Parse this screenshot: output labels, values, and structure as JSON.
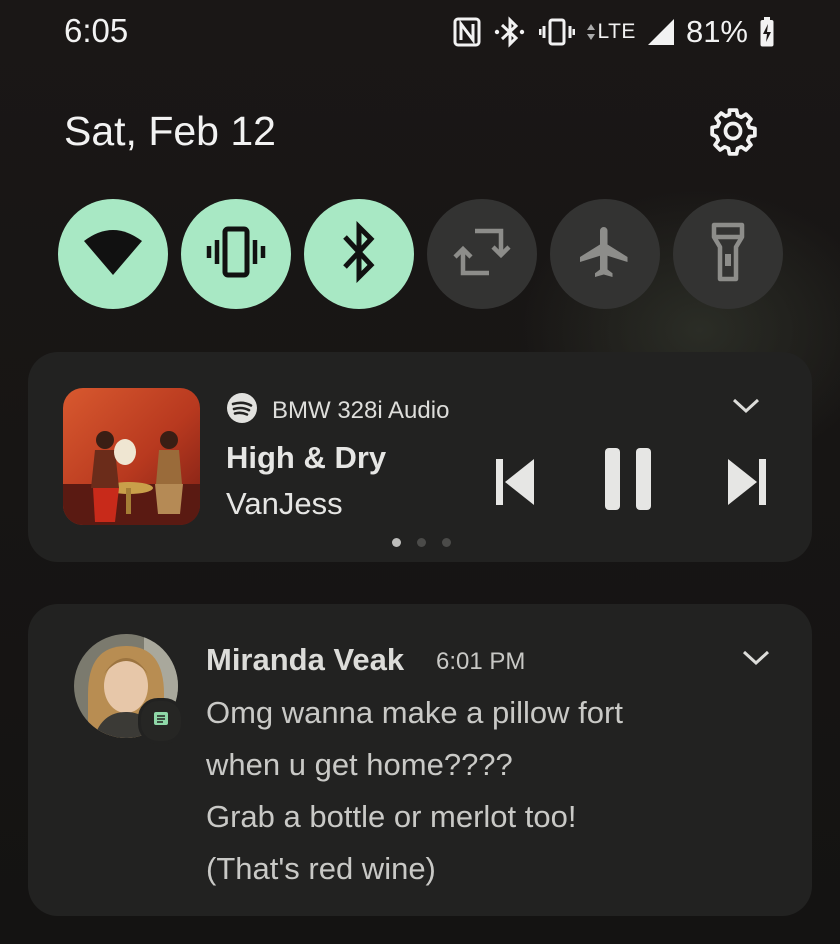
{
  "status_bar": {
    "time": "6:05",
    "network": "LTE",
    "battery": "81%",
    "icons": [
      "nfc-icon",
      "bluetooth-icon",
      "vibrate-icon",
      "data-arrows-icon",
      "signal-icon",
      "battery-charging-icon"
    ]
  },
  "header": {
    "date": "Sat, Feb 12",
    "settings_icon": "gear-icon"
  },
  "quick_settings": [
    {
      "name": "wifi",
      "icon": "wifi-icon",
      "active": true
    },
    {
      "name": "vibrate",
      "icon": "vibrate-icon",
      "active": true
    },
    {
      "name": "bluetooth",
      "icon": "bluetooth-icon",
      "active": true
    },
    {
      "name": "auto-rotate",
      "icon": "rotate-icon",
      "active": false
    },
    {
      "name": "airplane-mode",
      "icon": "airplane-icon",
      "active": false
    },
    {
      "name": "flashlight",
      "icon": "flashlight-icon",
      "active": false
    }
  ],
  "media": {
    "app_icon": "spotify-icon",
    "output_device": "BMW 328i Audio",
    "title": "High & Dry",
    "artist": "VanJess",
    "state": "playing",
    "page_count": 3,
    "current_page": 1
  },
  "message": {
    "sender": "Miranda Veak",
    "time": "6:01 PM",
    "app_badge_icon": "messages-icon",
    "lines": [
      "Omg wanna make a pillow fort",
      "when u get home????",
      "Grab a bottle or merlot too!",
      "(That's red wine)"
    ]
  },
  "colors": {
    "tile_active": "#a8e8c4",
    "tile_inactive": "#333332",
    "card_background": "#222221"
  }
}
